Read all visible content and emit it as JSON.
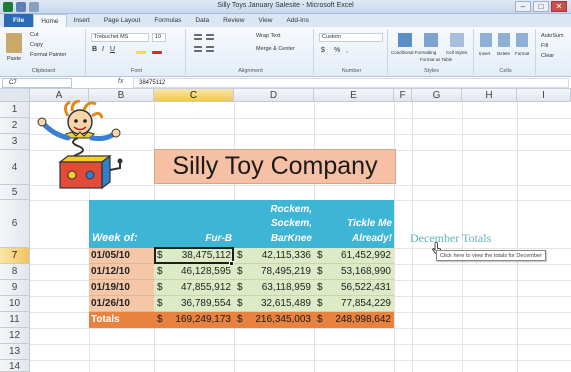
{
  "window": {
    "title": "Silly Toys January Salesite - Microsoft Excel",
    "minimize": "–",
    "restore": "□",
    "close": "✕"
  },
  "tabs": [
    {
      "label": "File"
    },
    {
      "label": "Home"
    },
    {
      "label": "Insert"
    },
    {
      "label": "Page Layout"
    },
    {
      "label": "Formulas"
    },
    {
      "label": "Data"
    },
    {
      "label": "Review"
    },
    {
      "label": "View"
    },
    {
      "label": "Add-Ins"
    }
  ],
  "ribbon": {
    "clipboard": {
      "label": "Clipboard",
      "paste": "Paste",
      "cut": "Cut",
      "copy": "Copy",
      "format_painter": "Format Painter"
    },
    "font": {
      "label": "Font",
      "name": "Trebuchet MS",
      "size": "10"
    },
    "alignment": {
      "label": "Alignment",
      "wrap_text": "Wrap Text",
      "merge_center": "Merge & Center"
    },
    "number": {
      "label": "Number",
      "format": "Custom",
      "currency": "$",
      "percent": "%",
      "comma": ","
    },
    "styles": {
      "label": "Styles",
      "conditional": "Conditional Formatting",
      "format_table": "Format as Table",
      "cell_styles": "Cell Styles"
    },
    "cells": {
      "label": "Cells",
      "insert": "Insert",
      "delete": "Delete",
      "format": "Format"
    },
    "editing": {
      "autosum": "AutoSum",
      "fill": "Fill",
      "clear": "Clear"
    }
  },
  "formula_bar": {
    "name_box": "C7",
    "fx": "fx",
    "content": "38475112"
  },
  "columns": [
    "A",
    "B",
    "C",
    "D",
    "E",
    "F",
    "G",
    "H",
    "I"
  ],
  "rows": [
    "1",
    "2",
    "3",
    "4",
    "5",
    "6",
    "7",
    "8",
    "9",
    "10",
    "11",
    "12",
    "13",
    "14"
  ],
  "selected": {
    "column": "C",
    "row": "7"
  },
  "sheet": {
    "title": "Silly Toy Company",
    "week_of_header": "Week of:",
    "product_headers": [
      {
        "line1": "",
        "line2": "",
        "line3": "Fur-B"
      },
      {
        "line1": "Rockem,",
        "line2": "Sockem,",
        "line3": "BarKnee"
      },
      {
        "line1": "",
        "line2": "Tickle Me",
        "line3": "Already!"
      }
    ],
    "data_rows": [
      {
        "week": "01/05/10",
        "values": [
          "38,475,112",
          "42,115,336",
          "61,452,992"
        ]
      },
      {
        "week": "01/12/10",
        "values": [
          "46,128,595",
          "78,495,219",
          "53,168,990"
        ]
      },
      {
        "week": "01/19/10",
        "values": [
          "47,855,912",
          "63,118,959",
          "56,522,431"
        ]
      },
      {
        "week": "01/26/10",
        "values": [
          "36,789,554",
          "32,615,489",
          "77,854,229"
        ]
      }
    ],
    "currency_symbol": "$",
    "totals_label": "Totals",
    "totals": [
      "169,249,173",
      "216,345,003",
      "248,998,642"
    ],
    "hyperlink": "December Totals",
    "tooltip": "Click here to view the totals for December"
  },
  "colors": {
    "title_fill": "#f6c0a4",
    "header_fill": "#3fb5d6",
    "date_fill": "#f4c7a8",
    "value_fill": "#dcebc5",
    "totals_fill": "#e9823f",
    "link_color": "#62b3b5"
  },
  "icons": [
    "jack-in-the-box-clipart",
    "paste-icon",
    "fx-icon",
    "mouse-pointer-icon"
  ]
}
